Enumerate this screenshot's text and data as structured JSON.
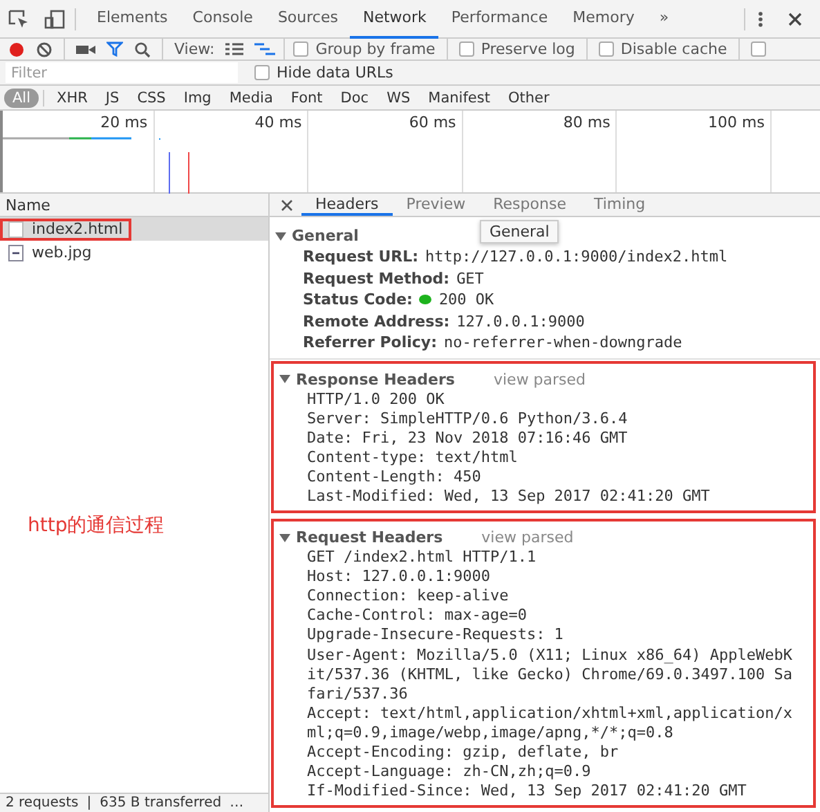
{
  "devtools_tabs": [
    {
      "label": "Elements",
      "selected": false
    },
    {
      "label": "Console",
      "selected": false
    },
    {
      "label": "Sources",
      "selected": false
    },
    {
      "label": "Network",
      "selected": true
    },
    {
      "label": "Performance",
      "selected": false
    },
    {
      "label": "Memory",
      "selected": false
    }
  ],
  "overflow": "»",
  "toolbar": {
    "recording": true,
    "filter_active": true,
    "view_label": "View:",
    "large_rows": false,
    "overview": true,
    "checkboxes": [
      {
        "label": "Group by frame",
        "checked": false
      },
      {
        "label": "Preserve log",
        "checked": false
      },
      {
        "label": "Disable cache",
        "checked": false
      }
    ],
    "extra_checkbox_checked": false
  },
  "filter": {
    "placeholder": "Filter",
    "hide_data_urls": {
      "label": "Hide data URLs",
      "checked": false
    }
  },
  "types": [
    {
      "label": "All",
      "selected": true
    },
    {
      "label": "XHR",
      "selected": false
    },
    {
      "label": "JS",
      "selected": false
    },
    {
      "label": "CSS",
      "selected": false
    },
    {
      "label": "Img",
      "selected": false
    },
    {
      "label": "Media",
      "selected": false
    },
    {
      "label": "Font",
      "selected": false
    },
    {
      "label": "Doc",
      "selected": false
    },
    {
      "label": "WS",
      "selected": false
    },
    {
      "label": "Manifest",
      "selected": false
    },
    {
      "label": "Other",
      "selected": false
    }
  ],
  "timeline": {
    "ticks": [
      "20 ms",
      "40 ms",
      "60 ms",
      "80 ms",
      "100 ms"
    ]
  },
  "requests": {
    "header": "Name",
    "items": [
      {
        "name": "index2.html",
        "kind": "document",
        "selected": true,
        "outlined": true
      },
      {
        "name": "web.jpg",
        "kind": "image",
        "selected": false,
        "outlined": false
      }
    ]
  },
  "annotation": "http的通信过程",
  "status_bar": {
    "requests": "2 requests",
    "separator": "|",
    "transferred": "635 B transferred",
    "more": "…"
  },
  "detail_tabs": [
    {
      "label": "Headers",
      "selected": true
    },
    {
      "label": "Preview",
      "selected": false
    },
    {
      "label": "Response",
      "selected": false
    },
    {
      "label": "Timing",
      "selected": false
    }
  ],
  "tooltip": "General",
  "general": {
    "title": "General",
    "expanded": true,
    "rows": [
      {
        "label": "Request URL:",
        "value": "http://127.0.0.1:9000/index2.html",
        "kind": "text"
      },
      {
        "label": "Request Method:",
        "value": "GET",
        "kind": "text"
      },
      {
        "label": "Status Code:",
        "value": "200 OK",
        "kind": "status"
      },
      {
        "label": "Remote Address:",
        "value": "127.0.0.1:9000",
        "kind": "text"
      },
      {
        "label": "Referrer Policy:",
        "value": "no-referrer-when-downgrade",
        "kind": "text"
      }
    ]
  },
  "response_headers": {
    "title": "Response Headers",
    "link": "view parsed",
    "expanded": true,
    "outlined": true,
    "lines": [
      "HTTP/1.0 200 OK",
      "Server: SimpleHTTP/0.6 Python/3.6.4",
      "Date: Fri, 23 Nov 2018 07:16:46 GMT",
      "Content-type: text/html",
      "Content-Length: 450",
      "Last-Modified: Wed, 13 Sep 2017 02:41:20 GMT"
    ]
  },
  "request_headers": {
    "title": "Request Headers",
    "link": "view parsed",
    "expanded": true,
    "outlined": true,
    "lines": [
      "GET /index2.html HTTP/1.1",
      "Host: 127.0.0.1:9000",
      "Connection: keep-alive",
      "Cache-Control: max-age=0",
      "Upgrade-Insecure-Requests: 1",
      "User-Agent: Mozilla/5.0 (X11; Linux x86_64) AppleWebKit/537.36 (KHTML, like Gecko) Chrome/69.0.3497.100 Safari/537.36",
      "Accept: text/html,application/xhtml+xml,application/xml;q=0.9,image/webp,image/apng,*/*;q=0.8",
      "Accept-Encoding: gzip, deflate, br",
      "Accept-Language: zh-CN,zh;q=0.9",
      "If-Modified-Since: Wed, 13 Sep 2017 02:41:20 GMT"
    ]
  }
}
